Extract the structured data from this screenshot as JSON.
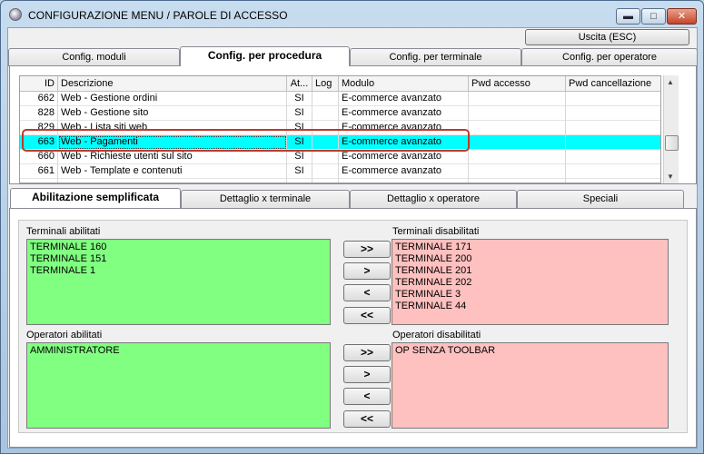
{
  "window": {
    "title": "CONFIGURAZIONE MENU / PAROLE DI ACCESSO",
    "controls": {
      "minimize": "▬",
      "maximize": "□",
      "close": "✕"
    }
  },
  "exit_button": "Uscita (ESC)",
  "top_tabs": [
    "Config. moduli",
    "Config. per procedura",
    "Config. per terminale",
    "Config. per operatore"
  ],
  "grid": {
    "headers": [
      "ID",
      "Descrizione",
      "At...",
      "Log",
      "Modulo",
      "Pwd accesso",
      "Pwd cancellazione"
    ],
    "rows": [
      {
        "id": "662",
        "desc": "Web - Gestione ordini",
        "att": "SI",
        "log": "",
        "modulo": "E-commerce avanzato",
        "pwa": "",
        "pwc": ""
      },
      {
        "id": "828",
        "desc": "Web - Gestione sito",
        "att": "SI",
        "log": "",
        "modulo": "E-commerce avanzato",
        "pwa": "",
        "pwc": ""
      },
      {
        "id": "829",
        "desc": "Web - Lista siti web",
        "att": "SI",
        "log": "",
        "modulo": "E-commerce avanzato",
        "pwa": "",
        "pwc": ""
      },
      {
        "id": "663",
        "desc": "Web - Pagamenti",
        "att": "SI",
        "log": "",
        "modulo": "E-commerce avanzato",
        "pwa": "",
        "pwc": ""
      },
      {
        "id": "660",
        "desc": "Web - Richieste utenti sul sito",
        "att": "SI",
        "log": "",
        "modulo": "E-commerce avanzato",
        "pwa": "",
        "pwc": ""
      },
      {
        "id": "661",
        "desc": "Web - Template e contenuti",
        "att": "SI",
        "log": "",
        "modulo": "E-commerce avanzato",
        "pwa": "",
        "pwc": ""
      },
      {
        "id": "",
        "desc": "",
        "att": "",
        "log": "",
        "modulo": "",
        "pwa": "",
        "pwc": ""
      }
    ],
    "selected_row_color": "#00ffff"
  },
  "bottom_tabs": [
    "Abilitazione semplificata",
    "Dettaglio x terminale",
    "Dettaglio x operatore",
    "Speciali"
  ],
  "panels": {
    "terminali_abilitati": {
      "label": "Terminali abilitati",
      "items": [
        "TERMINALE 160",
        "TERMINALE 151",
        "TERMINALE 1"
      ]
    },
    "terminali_disabilitati": {
      "label": "Terminali disabilitati",
      "items": [
        "TERMINALE 171",
        "TERMINALE 200",
        "TERMINALE 201",
        "TERMINALE 202",
        "TERMINALE 3",
        "TERMINALE 44"
      ]
    },
    "operatori_abilitati": {
      "label": "Operatori abilitati",
      "items": [
        "AMMINISTRATORE"
      ]
    },
    "operatori_disabilitati": {
      "label": "Operatori disabilitati",
      "items": [
        "OP SENZA TOOLBAR"
      ]
    }
  },
  "move_buttons": {
    "all_right": ">>",
    "one_right": ">",
    "one_left": "<",
    "all_left": "<<"
  },
  "colors": {
    "enabled_list": "#80ff80",
    "disabled_list": "#ffc0c0",
    "highlight_border": "#c0392b"
  }
}
